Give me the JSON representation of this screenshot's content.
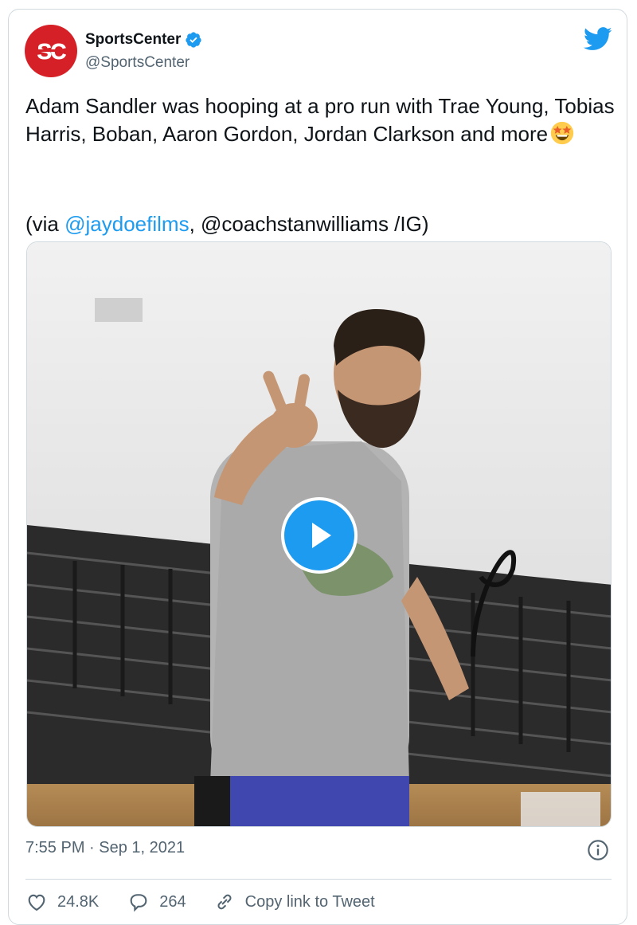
{
  "account": {
    "display_name": "SportsCenter",
    "handle": "@SportsCenter",
    "avatar_text": "SC",
    "verified": true
  },
  "tweet": {
    "text": "Adam Sandler was hooping at a pro run with Trae Young, Tobias Harris, Boban, Aaron Gordon, Jordan Clarkson and more",
    "emoji": "star-struck-emoji",
    "via_prefix": "(via ",
    "via_mention_1": "@jaydoefilms",
    "via_separator": ", @coachstanwilliams /IG)",
    "timestamp": "7:55 PM · Sep 1, 2021"
  },
  "media": {
    "type": "video",
    "play_icon": "play-icon"
  },
  "actions": {
    "likes": "24.8K",
    "replies": "264",
    "copy_link_label": "Copy link to Tweet"
  },
  "colors": {
    "brand_blue": "#1d9bf0",
    "avatar_red": "#d62027",
    "text_primary": "#0f1419",
    "text_secondary": "#536471",
    "border": "#cfd9de"
  }
}
